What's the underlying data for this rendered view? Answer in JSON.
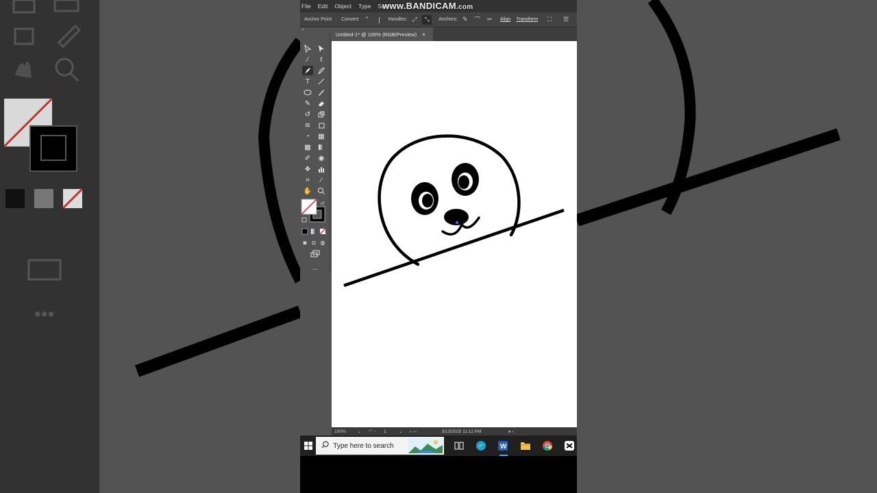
{
  "watermark": {
    "main": "www.BANDICAM",
    "suffix": ".com"
  },
  "menubar": {
    "items": [
      "File",
      "Edit",
      "Object",
      "Type",
      "Sele"
    ]
  },
  "controlbar": {
    "tool_name": "Anchor Point",
    "convert_label": "Convert:",
    "handles_label": "Handles:",
    "anchors_label": "Anchors:",
    "align_label": "Align",
    "transform_label": "Transform"
  },
  "document": {
    "tab_title": "Untitled-1* @ 100% (RGB/Preview)",
    "close_glyph": "×"
  },
  "statusbar": {
    "zoom": "100%",
    "artboard_number": "1",
    "datetime": "3/13/2025  11:12 PM"
  },
  "taskbar": {
    "search_placeholder": "Type here to search"
  },
  "tools": {
    "more_label": "..."
  },
  "colors": {
    "panel_dark": "#323232",
    "panel_mid": "#535353",
    "artboard": "#ffffff",
    "stroke": "#000000",
    "taskbar": "#202020"
  },
  "icons": [
    "selection-icon",
    "direct-selection-icon",
    "magic-wand-icon",
    "lasso-icon",
    "pen-icon",
    "curvature-icon",
    "type-icon",
    "line-icon",
    "ellipse-icon",
    "paintbrush-icon",
    "shaper-icon",
    "eraser-icon",
    "rotate-icon",
    "scale-icon",
    "warp-icon",
    "free-transform-icon",
    "shape-builder-icon",
    "perspective-icon",
    "mesh-icon",
    "gradient-icon",
    "eyedropper-icon",
    "blend-icon",
    "symbol-sprayer-icon",
    "graph-icon",
    "artboard-icon",
    "slice-icon",
    "hand-icon",
    "zoom-icon",
    "windows-start-icon",
    "search-icon",
    "task-view-icon",
    "edge-icon",
    "word-icon",
    "file-explorer-icon",
    "chrome-icon",
    "capcut-icon"
  ]
}
